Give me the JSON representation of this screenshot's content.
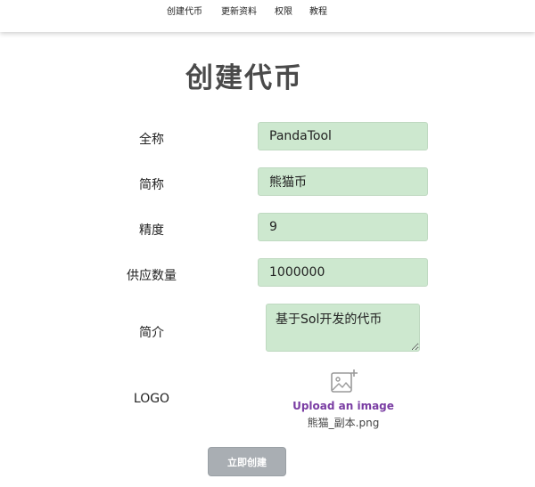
{
  "nav": {
    "items": [
      {
        "label": "创建代币"
      },
      {
        "label": "更新资料"
      },
      {
        "label": "权限"
      },
      {
        "label": "教程"
      }
    ]
  },
  "page": {
    "title": "创建代币"
  },
  "form": {
    "full_name": {
      "label": "全称",
      "value": "PandaTool"
    },
    "symbol": {
      "label": "简称",
      "value": "熊猫币"
    },
    "decimals": {
      "label": "精度",
      "value": "9"
    },
    "supply": {
      "label": "供应数量",
      "value": "1000000"
    },
    "description": {
      "label": "简介",
      "value": "基于Sol开发的代币"
    },
    "logo": {
      "label": "LOGO",
      "icon": "image-add-icon",
      "upload_label": "Upload an image",
      "file_name": "熊猫_副本.png"
    },
    "submit_label": "立即创建"
  },
  "colors": {
    "field_background": "#cde8cf",
    "upload_link": "#7a3da3",
    "submit_disabled": "#a9aeb3"
  }
}
